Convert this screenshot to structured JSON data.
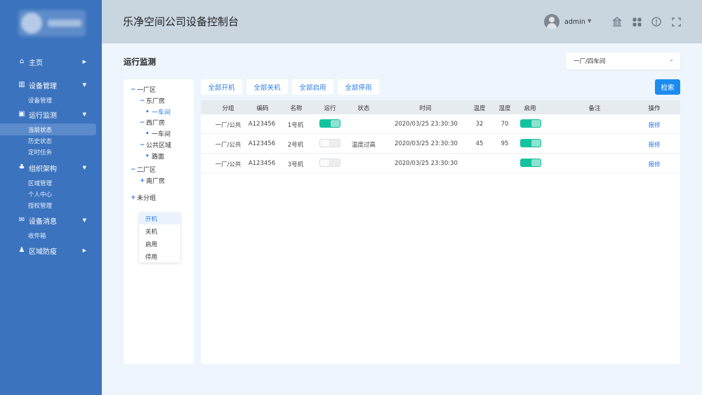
{
  "app": {
    "title": "乐净空间公司设备控制台"
  },
  "header": {
    "username": "admin"
  },
  "sidebar": {
    "groups": [
      {
        "label": "主页",
        "icon": "home-icon"
      },
      {
        "label": "设备管理",
        "icon": "device-icon",
        "items": [
          "设备管理"
        ]
      },
      {
        "label": "运行监测",
        "icon": "monitor-icon",
        "items": [
          "当前状态",
          "历史状态",
          "定时任务"
        ]
      },
      {
        "label": "组织架构",
        "icon": "org-icon",
        "items": [
          "区域管理",
          "个人中心",
          "授权管理"
        ]
      },
      {
        "label": "设备消息",
        "icon": "message-icon",
        "items": [
          "收件箱"
        ]
      },
      {
        "label": "区域防疫",
        "icon": "epidemic-icon"
      }
    ]
  },
  "main": {
    "page_title": "运行监测",
    "region_select": {
      "value": "一厂/四车间"
    },
    "buttons": {
      "all_on": "全部开机",
      "all_off": "全部关机",
      "all_enable": "全部启用",
      "all_disable": "全部停用",
      "search": "检索"
    }
  },
  "tree": {
    "nodes": [
      {
        "toggle": "−",
        "label": "一厂区"
      },
      {
        "toggle": "−",
        "label": "东厂房"
      },
      {
        "toggle": "•",
        "label": "一车间"
      },
      {
        "toggle": "−",
        "label": "西厂房"
      },
      {
        "toggle": "•",
        "label": "一车间"
      },
      {
        "toggle": "−",
        "label": "公共区域"
      },
      {
        "toggle": "•",
        "label": "路面"
      },
      {
        "toggle": "−",
        "label": "二厂区"
      },
      {
        "toggle": "+",
        "label": "南厂房"
      },
      {
        "toggle": "+",
        "label": "未分组"
      }
    ],
    "filter_options": [
      "开机",
      "关机",
      "启用",
      "停用"
    ]
  },
  "table": {
    "headers": [
      "分组",
      "编码",
      "名称",
      "运行",
      "状态",
      "时间",
      "温度",
      "湿度",
      "启用",
      "备注",
      "操作"
    ],
    "rows": [
      {
        "group": "一厂/公共",
        "code": "A123456",
        "name": "1号机",
        "running": true,
        "status": "",
        "time": "2020/03/25 23:30:30",
        "temp": "32",
        "humidity": "70",
        "enabled": true,
        "note": "",
        "action": "报修"
      },
      {
        "group": "一厂/公共",
        "code": "A123456",
        "name": "2号机",
        "running": false,
        "status": "温度过高",
        "time": "2020/03/25 23:30:30",
        "temp": "45",
        "humidity": "95",
        "enabled": true,
        "note": "",
        "action": "报修"
      },
      {
        "group": "一厂/公共",
        "code": "A123456",
        "name": "3号机",
        "running": false,
        "status": "",
        "time": "2020/03/25 23:30:30",
        "temp": "",
        "humidity": "",
        "enabled": true,
        "note": "",
        "action": "报修"
      }
    ]
  }
}
